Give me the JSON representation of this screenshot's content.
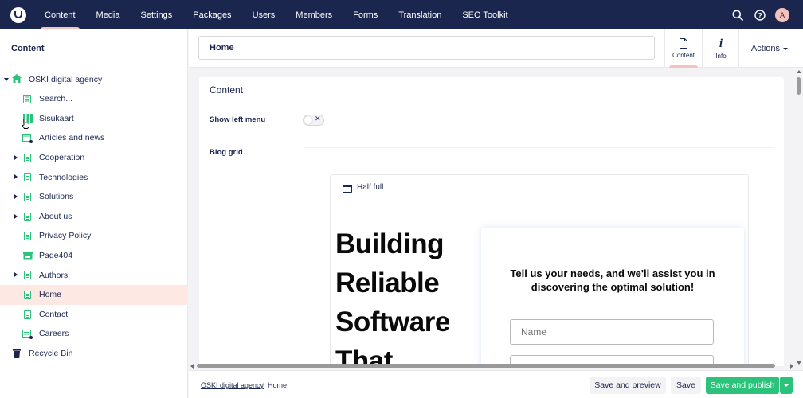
{
  "nav": {
    "items": [
      {
        "label": "Content",
        "active": true
      },
      {
        "label": "Media"
      },
      {
        "label": "Settings"
      },
      {
        "label": "Packages"
      },
      {
        "label": "Users"
      },
      {
        "label": "Members"
      },
      {
        "label": "Forms"
      },
      {
        "label": "Translation"
      },
      {
        "label": "SEO Toolkit"
      }
    ],
    "user_initial": "A"
  },
  "sidebar": {
    "title": "Content",
    "root": "OSKI digital agency",
    "items": [
      {
        "label": "Search...",
        "icon": "search-doc-icon"
      },
      {
        "label": "Sisukaart",
        "icon": "sitemap-icon"
      },
      {
        "label": "Articles and news",
        "icon": "calendar-icon"
      },
      {
        "label": "Cooperation",
        "icon": "doc-icon",
        "expandable": true
      },
      {
        "label": "Technologies",
        "icon": "doc-icon",
        "expandable": true
      },
      {
        "label": "Solutions",
        "icon": "doc-icon",
        "expandable": true
      },
      {
        "label": "About us",
        "icon": "doc-icon",
        "expandable": true
      },
      {
        "label": "Privacy Policy",
        "icon": "doc-icon"
      },
      {
        "label": "Page404",
        "icon": "page404-icon"
      },
      {
        "label": "Authors",
        "icon": "doc-icon",
        "expandable": true
      },
      {
        "label": "Home",
        "icon": "doc-icon",
        "active": true
      },
      {
        "label": "Contact",
        "icon": "doc-icon"
      },
      {
        "label": "Careers",
        "icon": "careers-icon"
      }
    ],
    "recycle_bin": "Recycle Bin"
  },
  "header": {
    "name_value": "Home",
    "apps": [
      {
        "label": "Content",
        "active": true
      },
      {
        "label": "Info"
      }
    ],
    "actions_label": "Actions"
  },
  "content": {
    "group_title": "Content",
    "show_left_menu_label": "Show left menu",
    "toggle_off_symbol": "✕",
    "blog_grid_label": "Blog grid",
    "layout_label": "Half full",
    "hero_lines": [
      "Building",
      "Reliable",
      "Software",
      "That"
    ],
    "form_heading": "Tell us your needs, and we'll assist you in discovering the optimal solution!",
    "name_placeholder": "Name"
  },
  "footer": {
    "breadcrumb": [
      "OSKI digital agency",
      "Home"
    ],
    "breadcrumb_separator": "/",
    "save_preview_label": "Save and preview",
    "save_label": "Save",
    "save_publish_label": "Save and publish"
  },
  "colors": {
    "nav_bg": "#1b264f",
    "accent_pink": "#f5c1bc",
    "success_green": "#2bc37c",
    "active_row": "#fde8e4"
  }
}
